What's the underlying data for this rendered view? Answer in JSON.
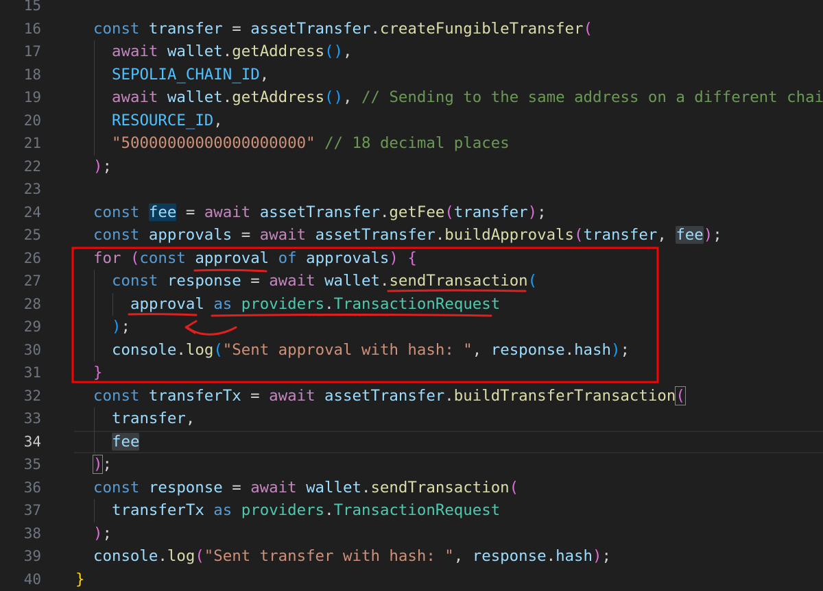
{
  "editor": {
    "current_line": 34,
    "lines": [
      {
        "n": "15",
        "indent": 0,
        "tokens": []
      },
      {
        "n": "16",
        "indent": 1,
        "tokens": [
          [
            "k",
            "const"
          ],
          [
            "p",
            " "
          ],
          [
            "v",
            "transfer"
          ],
          [
            "p",
            " = "
          ],
          [
            "v",
            "assetTransfer"
          ],
          [
            "p",
            "."
          ],
          [
            "f",
            "createFungibleTransfer"
          ],
          [
            "b1",
            "("
          ]
        ]
      },
      {
        "n": "17",
        "indent": 2,
        "tokens": [
          [
            "c",
            "await"
          ],
          [
            "p",
            " "
          ],
          [
            "v",
            "wallet"
          ],
          [
            "p",
            "."
          ],
          [
            "f",
            "getAddress"
          ],
          [
            "b2",
            "()"
          ],
          [
            "p",
            ","
          ]
        ]
      },
      {
        "n": "18",
        "indent": 2,
        "tokens": [
          [
            "con",
            "SEPOLIA_CHAIN_ID"
          ],
          [
            "p",
            ","
          ]
        ]
      },
      {
        "n": "19",
        "indent": 2,
        "tokens": [
          [
            "c",
            "await"
          ],
          [
            "p",
            " "
          ],
          [
            "v",
            "wallet"
          ],
          [
            "p",
            "."
          ],
          [
            "f",
            "getAddress"
          ],
          [
            "b2",
            "()"
          ],
          [
            "p",
            ", "
          ],
          [
            "cm",
            "// Sending to the same address on a different chain"
          ]
        ]
      },
      {
        "n": "20",
        "indent": 2,
        "tokens": [
          [
            "con",
            "RESOURCE_ID"
          ],
          [
            "p",
            ","
          ]
        ]
      },
      {
        "n": "21",
        "indent": 2,
        "tokens": [
          [
            "s",
            "\"50000000000000000000\""
          ],
          [
            "p",
            " "
          ],
          [
            "cm",
            "// 18 decimal places"
          ]
        ]
      },
      {
        "n": "22",
        "indent": 1,
        "tokens": [
          [
            "b1",
            ")"
          ],
          [
            "p",
            ";"
          ]
        ]
      },
      {
        "n": "23",
        "indent": 0,
        "tokens": []
      },
      {
        "n": "24",
        "indent": 1,
        "tokens": [
          [
            "k",
            "const"
          ],
          [
            "p",
            " "
          ],
          [
            "v hl",
            "fee"
          ],
          [
            "p",
            " = "
          ],
          [
            "c",
            "await"
          ],
          [
            "p",
            " "
          ],
          [
            "v",
            "assetTransfer"
          ],
          [
            "p",
            "."
          ],
          [
            "f",
            "getFee"
          ],
          [
            "b1",
            "("
          ],
          [
            "v",
            "transfer"
          ],
          [
            "b1",
            ")"
          ],
          [
            "p",
            ";"
          ]
        ]
      },
      {
        "n": "25",
        "indent": 1,
        "tokens": [
          [
            "k",
            "const"
          ],
          [
            "p",
            " "
          ],
          [
            "v",
            "approvals"
          ],
          [
            "p",
            " = "
          ],
          [
            "c",
            "await"
          ],
          [
            "p",
            " "
          ],
          [
            "v",
            "assetTransfer"
          ],
          [
            "p",
            "."
          ],
          [
            "f",
            "buildApprovals"
          ],
          [
            "b1",
            "("
          ],
          [
            "v",
            "transfer"
          ],
          [
            "p",
            ", "
          ],
          [
            "v hl2",
            "fee"
          ],
          [
            "b1",
            ")"
          ],
          [
            "p",
            ";"
          ]
        ]
      },
      {
        "n": "26",
        "indent": 1,
        "tokens": [
          [
            "c",
            "for"
          ],
          [
            "p",
            " "
          ],
          [
            "b1",
            "("
          ],
          [
            "k",
            "const"
          ],
          [
            "p",
            " "
          ],
          [
            "v",
            "approval"
          ],
          [
            "p",
            " "
          ],
          [
            "k",
            "of"
          ],
          [
            "p",
            " "
          ],
          [
            "v",
            "approvals"
          ],
          [
            "b1",
            ")"
          ],
          [
            "p",
            " "
          ],
          [
            "b1",
            "{"
          ]
        ]
      },
      {
        "n": "27",
        "indent": 2,
        "tokens": [
          [
            "k",
            "const"
          ],
          [
            "p",
            " "
          ],
          [
            "v",
            "response"
          ],
          [
            "p",
            " = "
          ],
          [
            "c",
            "await"
          ],
          [
            "p",
            " "
          ],
          [
            "v",
            "wallet"
          ],
          [
            "p",
            "."
          ],
          [
            "f",
            "sendTransaction"
          ],
          [
            "b2",
            "("
          ]
        ]
      },
      {
        "n": "28",
        "indent": 3,
        "tokens": [
          [
            "v",
            "approval"
          ],
          [
            "p",
            " "
          ],
          [
            "k",
            "as"
          ],
          [
            "p",
            " "
          ],
          [
            "t",
            "providers"
          ],
          [
            "p",
            "."
          ],
          [
            "t",
            "TransactionRequest"
          ]
        ]
      },
      {
        "n": "29",
        "indent": 2,
        "tokens": [
          [
            "b2",
            ")"
          ],
          [
            "p",
            ";"
          ]
        ]
      },
      {
        "n": "30",
        "indent": 2,
        "tokens": [
          [
            "v",
            "console"
          ],
          [
            "p",
            "."
          ],
          [
            "f",
            "log"
          ],
          [
            "b2",
            "("
          ],
          [
            "s",
            "\"Sent approval with hash: \""
          ],
          [
            "p",
            ", "
          ],
          [
            "v",
            "response"
          ],
          [
            "p",
            "."
          ],
          [
            "v",
            "hash"
          ],
          [
            "b2",
            ")"
          ],
          [
            "p",
            ";"
          ]
        ]
      },
      {
        "n": "31",
        "indent": 1,
        "tokens": [
          [
            "b1",
            "}"
          ]
        ]
      },
      {
        "n": "32",
        "indent": 1,
        "tokens": [
          [
            "k",
            "const"
          ],
          [
            "p",
            " "
          ],
          [
            "v",
            "transferTx"
          ],
          [
            "p",
            " = "
          ],
          [
            "c",
            "await"
          ],
          [
            "p",
            " "
          ],
          [
            "v",
            "assetTransfer"
          ],
          [
            "p",
            "."
          ],
          [
            "f",
            "buildTransferTransaction"
          ],
          [
            "b1 bm",
            "("
          ]
        ]
      },
      {
        "n": "33",
        "indent": 2,
        "tokens": [
          [
            "v",
            "transfer"
          ],
          [
            "p",
            ","
          ]
        ]
      },
      {
        "n": "34",
        "indent": 2,
        "tokens": [
          [
            "v hl2",
            "fee"
          ]
        ]
      },
      {
        "n": "35",
        "indent": 1,
        "tokens": [
          [
            "b1 bm",
            ")"
          ],
          [
            "p",
            ";"
          ]
        ]
      },
      {
        "n": "36",
        "indent": 1,
        "tokens": [
          [
            "k",
            "const"
          ],
          [
            "p",
            " "
          ],
          [
            "v",
            "response"
          ],
          [
            "p",
            " = "
          ],
          [
            "c",
            "await"
          ],
          [
            "p",
            " "
          ],
          [
            "v",
            "wallet"
          ],
          [
            "p",
            "."
          ],
          [
            "f",
            "sendTransaction"
          ],
          [
            "b1",
            "("
          ]
        ]
      },
      {
        "n": "37",
        "indent": 2,
        "tokens": [
          [
            "v",
            "transferTx"
          ],
          [
            "p",
            " "
          ],
          [
            "k",
            "as"
          ],
          [
            "p",
            " "
          ],
          [
            "t",
            "providers"
          ],
          [
            "p",
            "."
          ],
          [
            "t",
            "TransactionRequest"
          ]
        ]
      },
      {
        "n": "38",
        "indent": 1,
        "tokens": [
          [
            "b1",
            ")"
          ],
          [
            "p",
            ";"
          ]
        ]
      },
      {
        "n": "39",
        "indent": 1,
        "tokens": [
          [
            "v",
            "console"
          ],
          [
            "p",
            "."
          ],
          [
            "f",
            "log"
          ],
          [
            "b1",
            "("
          ],
          [
            "s",
            "\"Sent transfer with hash: \""
          ],
          [
            "p",
            ", "
          ],
          [
            "v",
            "response"
          ],
          [
            "p",
            "."
          ],
          [
            "v",
            "hash"
          ],
          [
            "b1",
            ")"
          ],
          [
            "p",
            ";"
          ]
        ]
      },
      {
        "n": "40",
        "indent": 0,
        "tokens": [
          [
            "b0",
            "}"
          ]
        ]
      }
    ]
  },
  "annotation": {
    "box_color": "#ff0000",
    "underline_color": "#e0201e"
  }
}
